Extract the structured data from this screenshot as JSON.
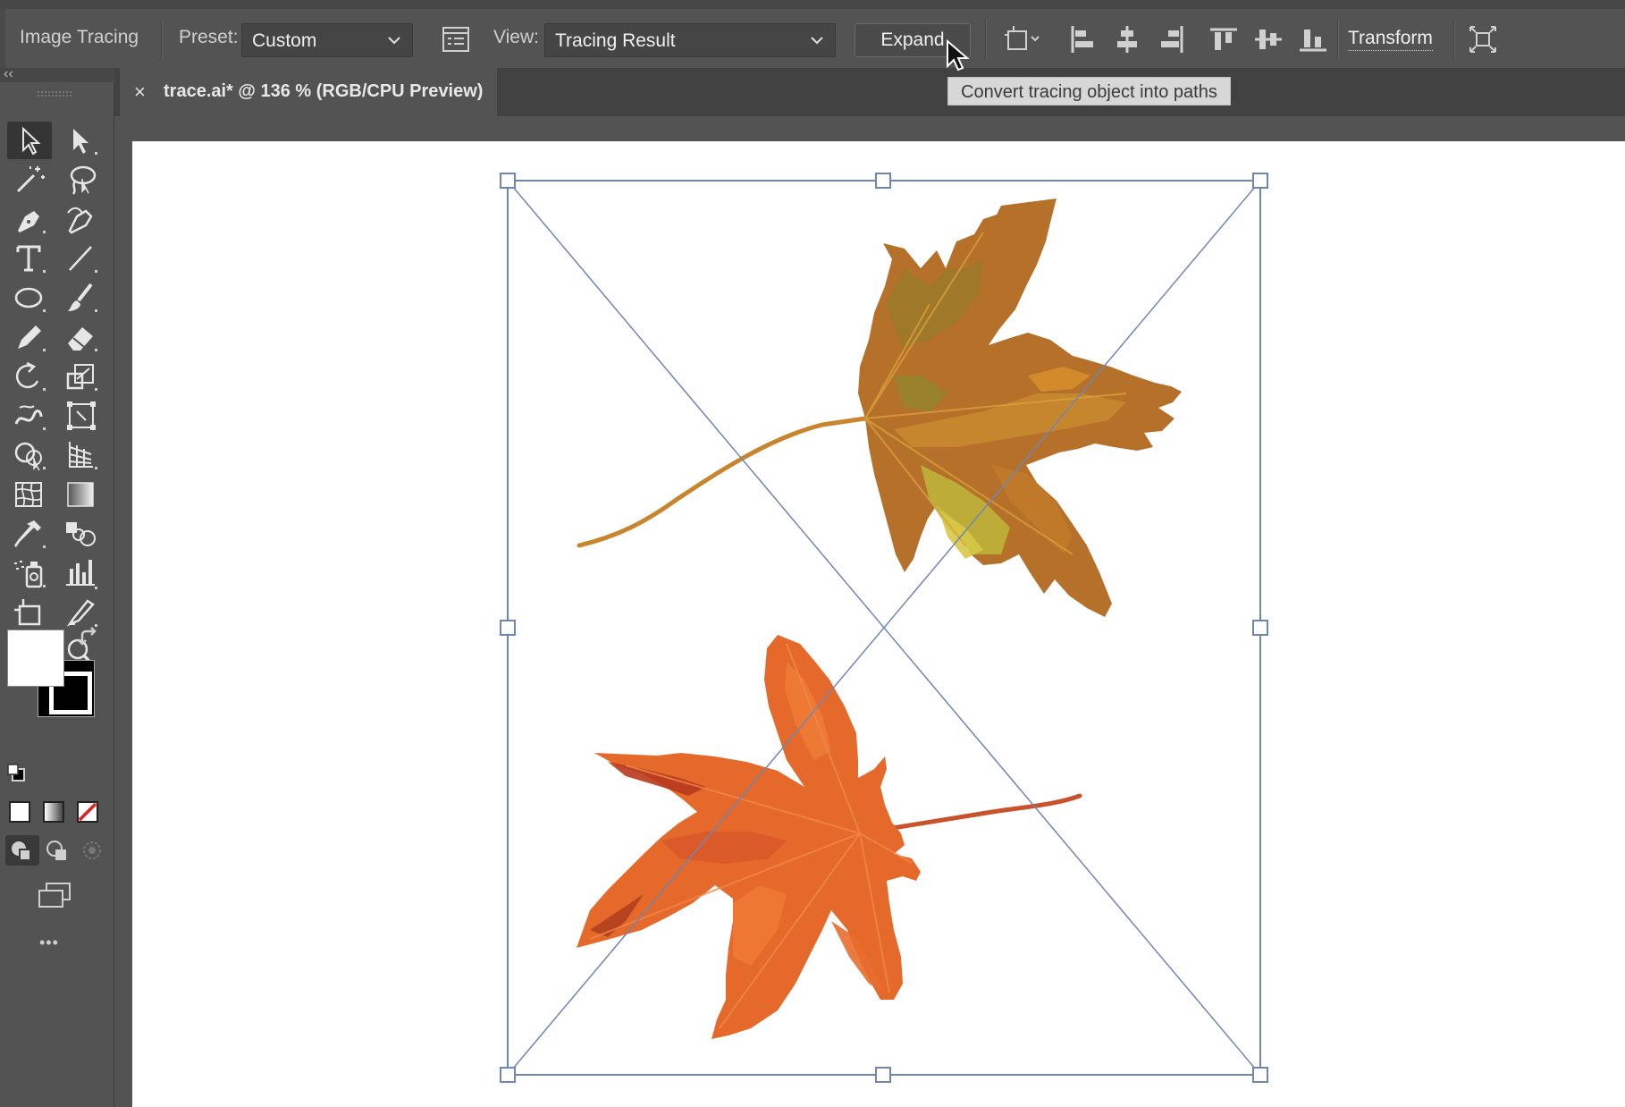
{
  "controlbar": {
    "panel_label": "Image Tracing",
    "preset_label": "Preset:",
    "preset_value": "Custom",
    "view_label": "View:",
    "view_value": "Tracing Result",
    "expand_label": "Expand",
    "transform_label": "Transform",
    "icons": [
      "tracing-panel-icon",
      "artboard-icon",
      "align-left-icon",
      "align-hcenter-icon",
      "align-right-icon",
      "align-top-icon",
      "align-vcenter-icon",
      "align-bottom-icon",
      "isolate-icon"
    ]
  },
  "tooltip": {
    "text": "Convert tracing object into paths"
  },
  "document": {
    "tab_title": "trace.ai* @ 136 % (RGB/CPU Preview)",
    "close_glyph": "×"
  },
  "toolbar": {
    "collapse_glyph": "‹‹",
    "more_glyph": "•••",
    "tools": [
      "selection-tool",
      "direct-selection-tool",
      "magic-wand-tool",
      "lasso-tool",
      "pen-tool",
      "curvature-tool",
      "type-tool",
      "line-tool",
      "ellipse-tool",
      "paintbrush-tool",
      "pencil-tool",
      "eraser-tool",
      "rotate-tool",
      "scale-tool",
      "warp-tool",
      "free-transform-tool",
      "shape-builder-tool",
      "perspective-grid-tool",
      "mesh-tool",
      "gradient-tool",
      "eyedropper-tool",
      "blend-tool",
      "symbol-sprayer-tool",
      "column-graph-tool",
      "artboard-tool",
      "slice-tool",
      "hand-tool",
      "zoom-tool"
    ],
    "fill_color": "#ffffff",
    "stroke_color": "#000000"
  },
  "colors": {
    "ui_bg": "#535353",
    "selection": "#6f86b5",
    "leaf_upper": "#b5702a",
    "leaf_lower": "#e4692a"
  }
}
